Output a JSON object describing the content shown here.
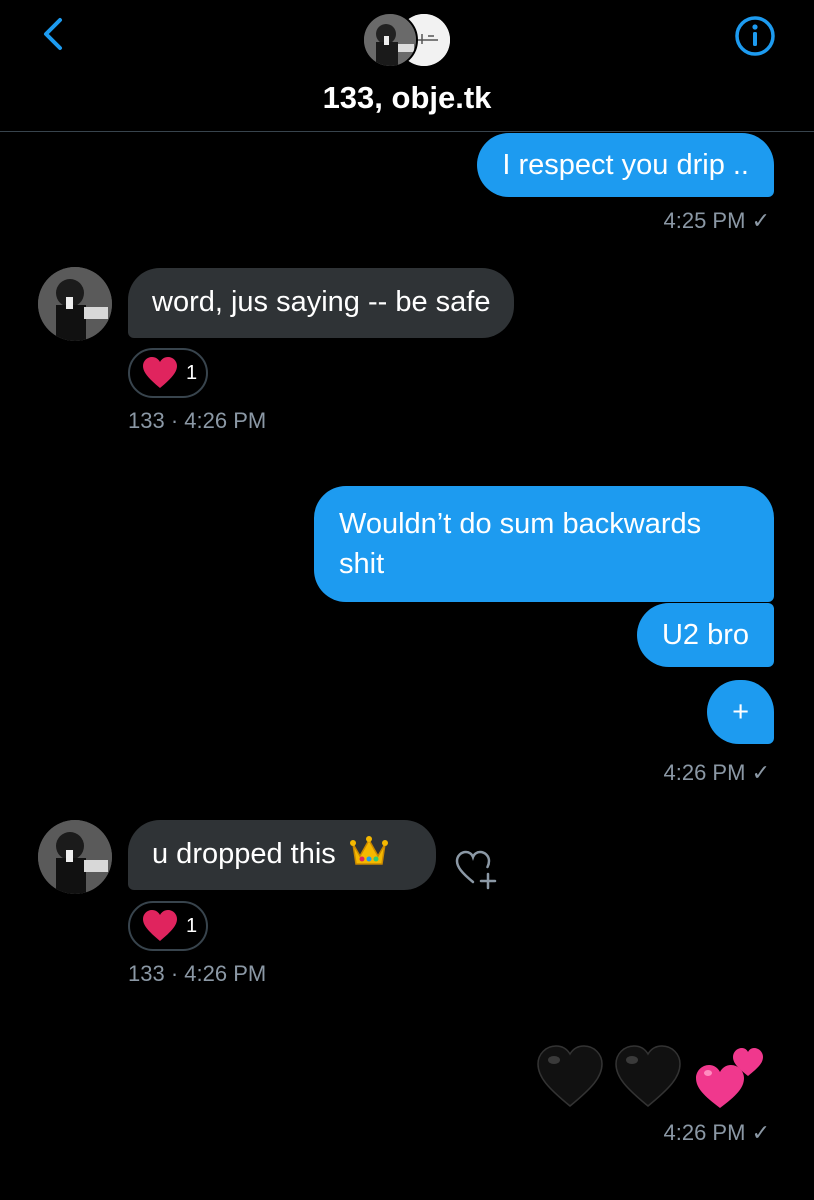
{
  "header": {
    "title": "133, obje.tk",
    "back_icon": "chevron-left-icon",
    "info_icon": "info-icon",
    "accent": "#1d9bf0"
  },
  "messages": [
    {
      "dir": "out",
      "text": "I respect you drip .."
    },
    {
      "dir": "out_time",
      "time": "4:25 PM",
      "status": "✓"
    },
    {
      "dir": "in",
      "text": "word, jus saying -- be safe",
      "reaction": {
        "emoji": "red-heart",
        "count": "1"
      }
    },
    {
      "dir": "in_meta",
      "meta": "133 · 4:26 PM"
    },
    {
      "dir": "out",
      "text": "Wouldn’t do sum backwards shit"
    },
    {
      "dir": "out",
      "text": "U2 bro"
    },
    {
      "dir": "out",
      "text": "+"
    },
    {
      "dir": "out_time",
      "time": "4:26 PM",
      "status": "✓"
    },
    {
      "dir": "in",
      "text": "u dropped this",
      "emoji": "crown",
      "reaction": {
        "emoji": "red-heart",
        "count": "1"
      }
    },
    {
      "dir": "in_meta",
      "meta": "133 · 4:26 PM"
    },
    {
      "dir": "out_emoji",
      "emojis": [
        "black-heart",
        "black-heart",
        "two-hearts"
      ]
    },
    {
      "dir": "out_time",
      "time": "4:26 PM",
      "status": "✓"
    }
  ],
  "colors": {
    "outgoing_bubble": "#1d9bf0",
    "incoming_bubble": "#2f3336",
    "meta_text": "#8b98a5",
    "heart": "#e0245e"
  }
}
